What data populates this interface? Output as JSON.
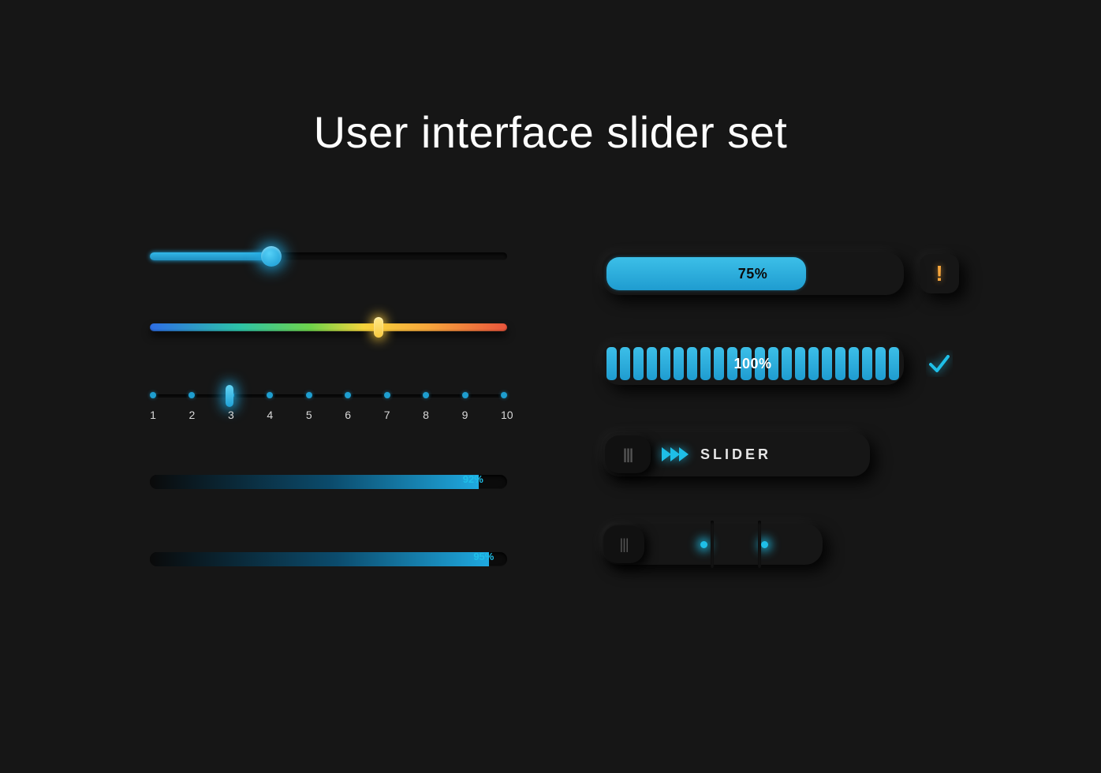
{
  "title": "User interface slider set",
  "colors": {
    "accent": "#1fbfe8",
    "warn": "#f7a63c"
  },
  "left": {
    "slider_blue": {
      "value_pct": 34
    },
    "slider_rainbow": {
      "value_pct": 64
    },
    "step": {
      "value": 3,
      "labels": [
        "1",
        "2",
        "3",
        "4",
        "5",
        "6",
        "7",
        "8",
        "9",
        "10"
      ]
    },
    "progress_a": {
      "value": 92,
      "label": "92%"
    },
    "progress_b": {
      "value": 95,
      "label": "95%"
    }
  },
  "right": {
    "bar75": {
      "value": 75,
      "label": "75%",
      "status_icon": "warning-icon"
    },
    "bar100": {
      "value": 100,
      "label": "100%",
      "status_icon": "check-icon",
      "segments": 22
    },
    "swipe": {
      "label": "SLIDER",
      "chevrons": 3
    },
    "selector": {
      "dots": 2
    }
  }
}
